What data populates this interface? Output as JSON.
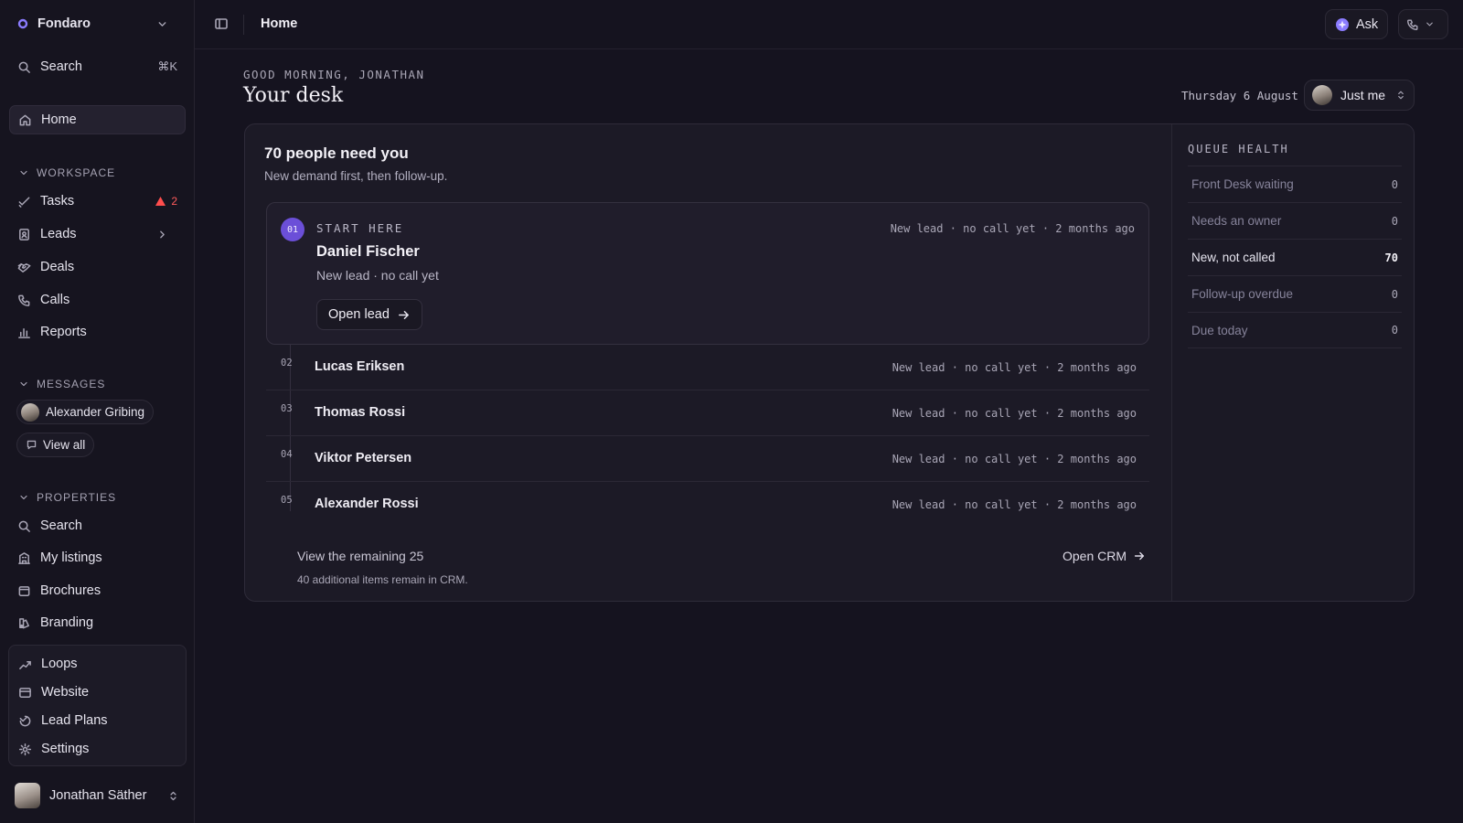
{
  "sidebar": {
    "workspace": "Fondaro",
    "search_label": "Search",
    "search_shortcut": "⌘K",
    "home_label": "Home",
    "workspace_section": "WORKSPACE",
    "workspace_items": [
      {
        "label": "Tasks",
        "icon": "check-icon",
        "badge": "2"
      },
      {
        "label": "Leads",
        "icon": "contact-book-icon"
      },
      {
        "label": "Deals",
        "icon": "handshake-icon"
      },
      {
        "label": "Calls",
        "icon": "phone-icon"
      },
      {
        "label": "Reports",
        "icon": "bar-chart-icon"
      }
    ],
    "messages_section": "MESSAGES",
    "message_contact": "Alexander Gribing",
    "view_all": "View all",
    "properties_section": "PROPERTIES",
    "property_items": [
      {
        "label": "Search",
        "icon": "search-icon"
      },
      {
        "label": "My listings",
        "icon": "building-icon"
      },
      {
        "label": "Brochures",
        "icon": "brochure-icon"
      },
      {
        "label": "Branding",
        "icon": "palette-icon"
      }
    ],
    "bottom_items": [
      {
        "label": "Loops",
        "icon": "loop-icon"
      },
      {
        "label": "Website",
        "icon": "browser-icon"
      },
      {
        "label": "Lead Plans",
        "icon": "plan-icon"
      },
      {
        "label": "Settings",
        "icon": "gear-icon"
      }
    ],
    "user_name": "Jonathan Säther"
  },
  "topbar": {
    "title": "Home",
    "ask_label": "Ask"
  },
  "main": {
    "greeting": "GOOD MORNING, JONATHAN",
    "title": "Your desk",
    "date": "Thursday 6 August",
    "scope": "Just me"
  },
  "queue": {
    "title": "70 people need you",
    "subtitle": "New demand first, then follow-up.",
    "featured": {
      "number": "01",
      "tag": "START HERE",
      "name": "Daniel Fischer",
      "status": "New lead · no call yet",
      "meta": "New lead · no call yet · 2 months ago",
      "action": "Open lead"
    },
    "rows": [
      {
        "number": "02",
        "name": "Lucas Eriksen",
        "meta": "New lead · no call yet · 2 months ago"
      },
      {
        "number": "03",
        "name": "Thomas Rossi",
        "meta": "New lead · no call yet · 2 months ago"
      },
      {
        "number": "04",
        "name": "Viktor Petersen",
        "meta": "New lead · no call yet · 2 months ago"
      },
      {
        "number": "05",
        "name": "Alexander Rossi",
        "meta": "New lead · no call yet · 2 months ago"
      }
    ],
    "remaining": "View the remaining 25",
    "remaining_sub": "40 additional items remain in CRM.",
    "open_crm": "Open CRM"
  },
  "queue_health": {
    "title": "QUEUE HEALTH",
    "rows": [
      {
        "label": "Front Desk waiting",
        "value": "0"
      },
      {
        "label": "Needs an owner",
        "value": "0"
      },
      {
        "label": "New, not called",
        "value": "70"
      },
      {
        "label": "Follow-up overdue",
        "value": "0"
      },
      {
        "label": "Due today",
        "value": "0"
      }
    ]
  },
  "colors": {
    "background": "#15131f",
    "accent": "#6b4fd8",
    "alert": "#ff5b5b"
  }
}
